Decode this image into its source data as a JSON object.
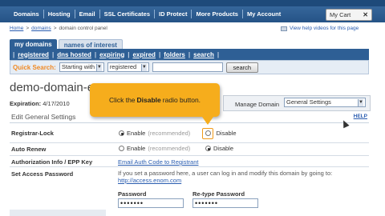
{
  "nav": {
    "items": [
      "Domains",
      "Hosting",
      "Email",
      "SSL Certificates",
      "ID Protect",
      "More Products",
      "My Account"
    ],
    "cart_label": "My Cart"
  },
  "breadcrumb": {
    "home": "Home",
    "sep": ">",
    "domains": "domains",
    "current": "domain control panel"
  },
  "help_video_link": "View help videos for this page",
  "tabs": {
    "active": "my domains",
    "inactive": "names of interest"
  },
  "subnav": [
    "registered",
    "dns hosted",
    "expiring",
    "expired",
    "folders",
    "search"
  ],
  "quick_search": {
    "label": "Quick Search:",
    "mode": "Starting with",
    "scope": "registered",
    "button": "search"
  },
  "domain": {
    "title": "demo-domain-e",
    "expiration_label": "Expiration:",
    "expiration_value": "4/17/2010"
  },
  "manage": {
    "label": "Manage Domain",
    "value": "General Settings"
  },
  "callout": {
    "pre": "Click the",
    "bold": "Disable",
    "post": "radio button."
  },
  "edit": {
    "title": "Edit General Settings",
    "help": "HELP"
  },
  "settings": {
    "registrar_lock": {
      "label": "Registrar-Lock",
      "enable": "Enable",
      "rec": "(recommended)",
      "disable": "Disable"
    },
    "auto_renew": {
      "label": "Auto Renew",
      "enable": "Enable",
      "rec": "(recommended)",
      "disable": "Disable"
    },
    "auth": {
      "label": "Authorization Info / EPP Key",
      "link": "Email Auth Code to Registrant"
    },
    "access_pw": {
      "label": "Set Access Password",
      "note": "If you set a password here, a user can log in and modify this domain by going to:",
      "url": "http://access.enom.com",
      "password_label": "Password",
      "retype_label": "Re-type Password",
      "password_mask": "•••••••",
      "retype_mask": "•••••••"
    }
  }
}
